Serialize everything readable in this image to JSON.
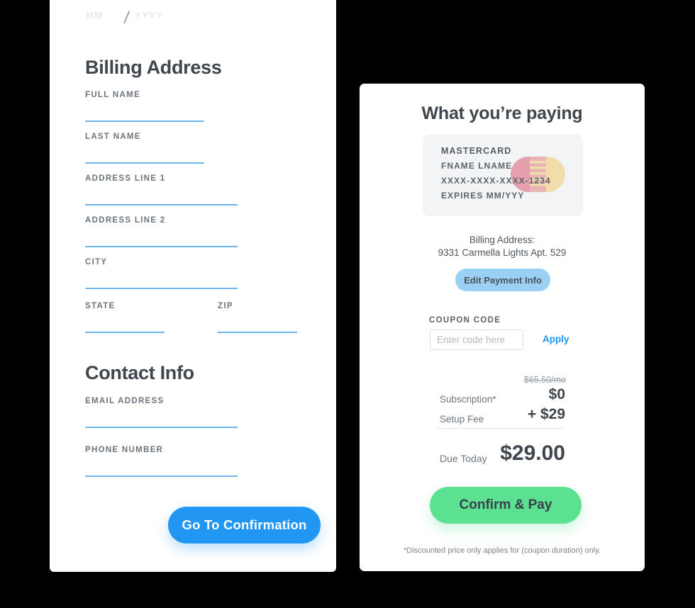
{
  "colors": {
    "page_background": "#000000",
    "card_background": "#ffffff",
    "accent_blue": "#2196f3",
    "underline_blue": "#6cb6ef",
    "accent_green": "#5ce092",
    "light_blue_button": "#9bd0f5",
    "heading_gray": "#3f464d",
    "label_gray": "#6c757d",
    "cc_box_background": "#f3f4f6",
    "mastercard_red": "#e4a0ac",
    "mastercard_yellow": "#f1dcab"
  },
  "form": {
    "expiry": {
      "month_placeholder": "MM",
      "separator": "/",
      "year_placeholder": "YYYY"
    },
    "billing_section_title": "Billing Address",
    "billing_fields": [
      {
        "label": "FULL NAME",
        "value": "",
        "line_width": 168
      },
      {
        "label": "LAST NAME",
        "value": "",
        "line_width": 168
      },
      {
        "label": "ADDRESS LINE 1",
        "value": "",
        "line_width": 215
      },
      {
        "label": "ADDRESS LINE 2",
        "value": "",
        "line_width": 215
      },
      {
        "label": "CITY",
        "value": "",
        "line_width": 215
      },
      {
        "label": "STATE",
        "value": "",
        "line_width": 112
      },
      {
        "label": "ZIP",
        "value": "",
        "line_width": 112
      }
    ],
    "contact_section_title": "Contact Info",
    "contact_fields": [
      {
        "label": "EMAIL ADDRESS",
        "value": "",
        "line_width": 215
      },
      {
        "label": "PHONE NUMBER",
        "value": "",
        "line_width": 215
      }
    ],
    "submit_button": "Go To Confirmation"
  },
  "summary": {
    "title": "What you’re paying",
    "credit_card": {
      "brand": "MASTERCARD",
      "name": "FNAME LNAME",
      "number": "XXXX-XXXX-XXXX-1234",
      "expires": "EXPIRES MM/YYY",
      "logo_icon": "mastercard-icon"
    },
    "billing_address_label": "Billing Address:",
    "billing_address_value": "9331 Carmella Lights Apt. 529",
    "edit_payment_button": "Edit Payment Info",
    "coupon": {
      "label": "COUPON CODE",
      "input_value": "",
      "placeholder": "Enter code here",
      "apply_link": "Apply"
    },
    "pricing": {
      "original_price": "$65.50/mo",
      "rows": [
        {
          "label": "Subscription*",
          "value": "$0"
        },
        {
          "label": "Setup Fee",
          "value": "+ $29"
        }
      ],
      "due_today_label": "Due Today",
      "due_today_value": "$29.00"
    },
    "confirm_button": "Confirm & Pay",
    "footnote": "*Discounted price only applies for (coupon duration) only."
  }
}
